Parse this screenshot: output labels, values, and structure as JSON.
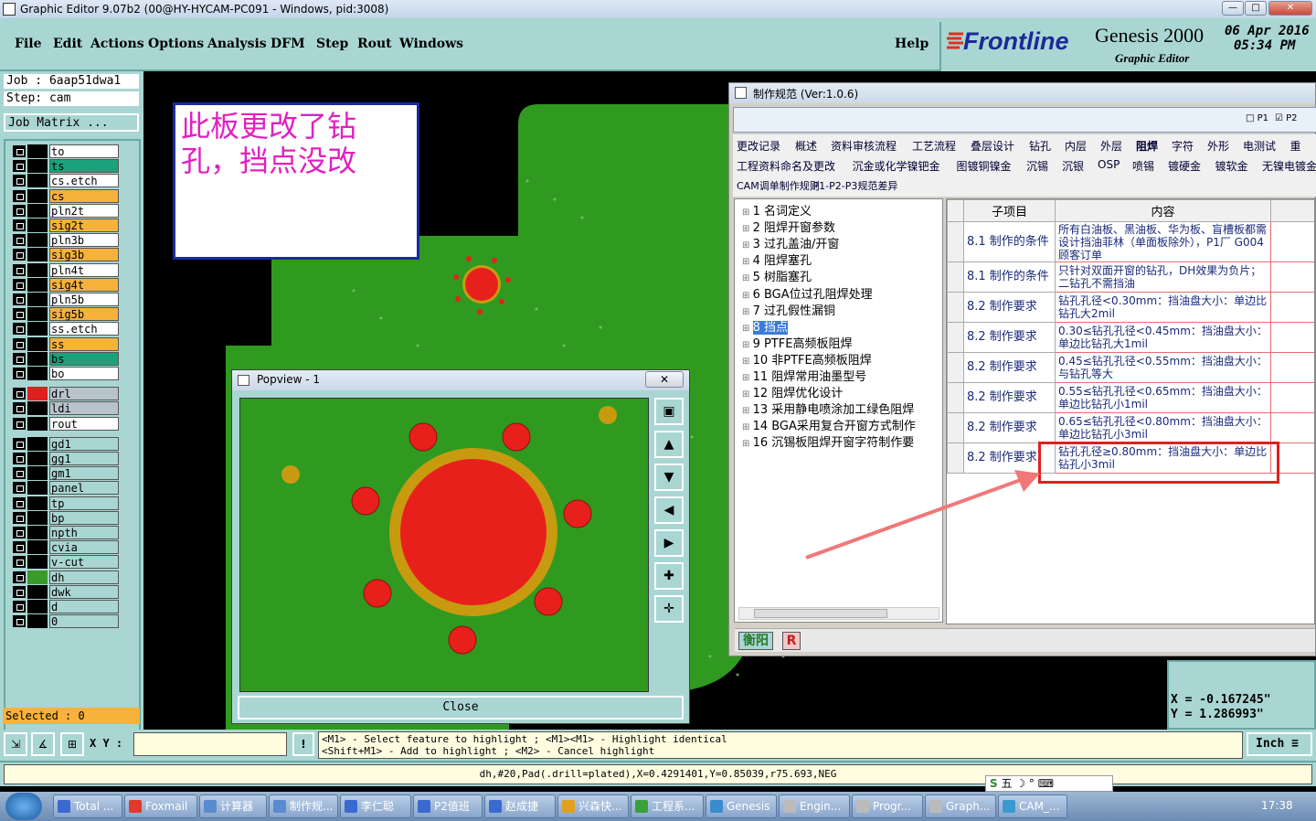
{
  "window": {
    "title": "Graphic Editor 9.07b2 (00@HY-HYCAM-PC091 - Windows, pid:3008)"
  },
  "menu": {
    "items": [
      "File",
      "Edit",
      "Actions",
      "Options",
      "Analysis",
      "DFM",
      "Step",
      "Rout",
      "Windows"
    ],
    "help": "Help"
  },
  "brand": {
    "logo": "Frontline",
    "product": "Genesis 2000",
    "subtitle": "Graphic Editor",
    "date": "06 Apr 2016",
    "time": "05:34 PM"
  },
  "job": {
    "job_line": "Job : 6aap51dwa1",
    "step_line": "Step: cam",
    "matrix_button": "Job Matrix ..."
  },
  "layers": [
    {
      "name": "to",
      "bg": "#ffffff",
      "sw": "#000000"
    },
    {
      "name": "ts",
      "bg": "#1aa37a",
      "sw": "#000000"
    },
    {
      "name": "cs.etch",
      "bg": "#ffffff",
      "sw": "#000000"
    },
    {
      "name": "cs",
      "bg": "#f6b23a",
      "sw": "#000000"
    },
    {
      "name": "pln2t",
      "bg": "#ffffff",
      "sw": "#000000"
    },
    {
      "name": "sig2t",
      "bg": "#f6b23a",
      "sw": "#000000"
    },
    {
      "name": "pln3b",
      "bg": "#ffffff",
      "sw": "#000000"
    },
    {
      "name": "sig3b",
      "bg": "#f6b23a",
      "sw": "#000000"
    },
    {
      "name": "pln4t",
      "bg": "#ffffff",
      "sw": "#000000"
    },
    {
      "name": "sig4t",
      "bg": "#f6b23a",
      "sw": "#000000"
    },
    {
      "name": "pln5b",
      "bg": "#ffffff",
      "sw": "#000000"
    },
    {
      "name": "sig5b",
      "bg": "#f6b23a",
      "sw": "#000000"
    },
    {
      "name": "ss.etch",
      "bg": "#ffffff",
      "sw": "#000000"
    },
    {
      "name": "ss",
      "bg": "#f6b23a",
      "sw": "#000000"
    },
    {
      "name": "bs",
      "bg": "#1aa37a",
      "sw": "#000000"
    },
    {
      "name": "bo",
      "bg": "#ffffff",
      "sw": "#000000"
    },
    {
      "name": "drl",
      "bg": "#b8c4cc",
      "sw": "#e02020"
    },
    {
      "name": "ldi",
      "bg": "#b8c4cc",
      "sw": "#000000"
    },
    {
      "name": "rout",
      "bg": "#ffffff",
      "sw": "#000000"
    },
    {
      "name": "gd1",
      "bg": "#a9d6d2",
      "sw": "#000000"
    },
    {
      "name": "gg1",
      "bg": "#a9d6d2",
      "sw": "#000000"
    },
    {
      "name": "gm1",
      "bg": "#a9d6d2",
      "sw": "#000000"
    },
    {
      "name": "panel",
      "bg": "#a9d6d2",
      "sw": "#000000"
    },
    {
      "name": "tp",
      "bg": "#a9d6d2",
      "sw": "#000000"
    },
    {
      "name": "bp",
      "bg": "#a9d6d2",
      "sw": "#000000"
    },
    {
      "name": "npth",
      "bg": "#a9d6d2",
      "sw": "#000000"
    },
    {
      "name": "cvia",
      "bg": "#a9d6d2",
      "sw": "#000000"
    },
    {
      "name": "v-cut",
      "bg": "#a9d6d2",
      "sw": "#000000"
    },
    {
      "name": "dh",
      "bg": "#a9d6d2",
      "sw": "#3a9b2a"
    },
    {
      "name": "dwk",
      "bg": "#a9d6d2",
      "sw": "#000000"
    },
    {
      "name": "d",
      "bg": "#a9d6d2",
      "sw": "#000000"
    },
    {
      "name": "0",
      "bg": "#a9d6d2",
      "sw": "#000000"
    }
  ],
  "selected": "Selected : 0",
  "note": {
    "text": "此板更改了钻孔，挡点没改"
  },
  "popview": {
    "title": "Popview - 1",
    "close_label": "Close"
  },
  "rules": {
    "title": "制作规范 (Ver:1.0.6)",
    "p1": "P1",
    "p2": "P2",
    "tabs_row1": [
      "更改记录",
      "概述",
      "资料审核流程",
      "工艺流程",
      "叠层设计",
      "钻孔",
      "内层",
      "外层",
      "阻焊",
      "字符",
      "外形",
      "电测试",
      "重"
    ],
    "tabs_row2": [
      "工程资料命名及更改",
      "沉金或化学镍钯金",
      "图镀铜镍金",
      "沉锡",
      "沉银",
      "OSP",
      "喷锡",
      "镀硬金",
      "镀软金",
      "无镍电镀金"
    ],
    "tabs_row3": [
      "CAM调单制作规则",
      "P1-P2-P3规范差异"
    ],
    "tree": [
      "1 名词定义",
      "2 阻焊开窗参数",
      "3 过孔盖油/开窗",
      "4 阻焊塞孔",
      "5 树脂塞孔",
      "6 BGA位过孔阻焊处理",
      "7 过孔假性漏铜",
      "8 挡点",
      "9 PTFE高频板阻焊",
      "10 非PTFE高频板阻焊",
      "11 阻焊常用油墨型号",
      "12 阻焊优化设计",
      "13 采用静电喷涂加工绿色阻焊",
      "14 BGA采用复合开窗方式制作",
      "16 沉锡板阻焊开窗字符制作要"
    ],
    "table_headers": [
      "子项目",
      "内容"
    ],
    "rows": [
      {
        "item": "8.1 制作的条件",
        "content": "所有白油板、黑油板、华为板、盲槽板都需设计挡油菲林（单面板除外），P1厂 G004 顾客订单"
      },
      {
        "item": "8.1 制作的条件",
        "content": "只针对双面开窗的钻孔，DH效果为负片；二钻孔不需挡油"
      },
      {
        "item": "8.2 制作要求",
        "content": "钻孔孔径<0.30mm：挡油盘大小：单边比钻孔大2mil"
      },
      {
        "item": "8.2 制作要求",
        "content": "0.30≤钻孔孔径<0.45mm：挡油盘大小：单边比钻孔大1mil"
      },
      {
        "item": "8.2 制作要求",
        "content": "0.45≤钻孔孔径<0.55mm：挡油盘大小：与钻孔等大"
      },
      {
        "item": "8.2 制作要求",
        "content": "0.55≤钻孔孔径<0.65mm：挡油盘大小：单边比钻孔小1mil"
      },
      {
        "item": "8.2 制作要求",
        "content": "0.65≤钻孔孔径<0.80mm：挡油盘大小：单边比钻孔小3mil"
      },
      {
        "item": "8.2 制作要求",
        "content": "钻孔孔径≥0.80mm：挡油盘大小：单边比钻孔小3mil"
      }
    ],
    "footer_label": "衡阳",
    "footer_r": "R"
  },
  "coords": {
    "x": "X = -0.167245\"",
    "y": "Y = 1.286993\""
  },
  "status": {
    "xy_label": "X Y :",
    "hint1": "<M1> - Select feature to highlight ; <M1><M1> - Highlight identical",
    "hint2": "<Shift+M1> - Add to highlight ; <M2> - Cancel highlight",
    "units": "Inch"
  },
  "infoline": "dh,#20,Pad(.drill=plated),X=0.4291401,Y=0.85039,r75.693,NEG",
  "taskbar": {
    "items": [
      "Total ...",
      "Foxmail",
      "计算器",
      "制作规...",
      "李仁聪",
      "P2值班",
      "赵成捷",
      "兴森快...",
      "工程系...",
      "Genesis",
      "Engin...",
      "Progr...",
      "Graph...",
      "CAM_..."
    ],
    "ime": "五",
    "clock": "17:38"
  }
}
